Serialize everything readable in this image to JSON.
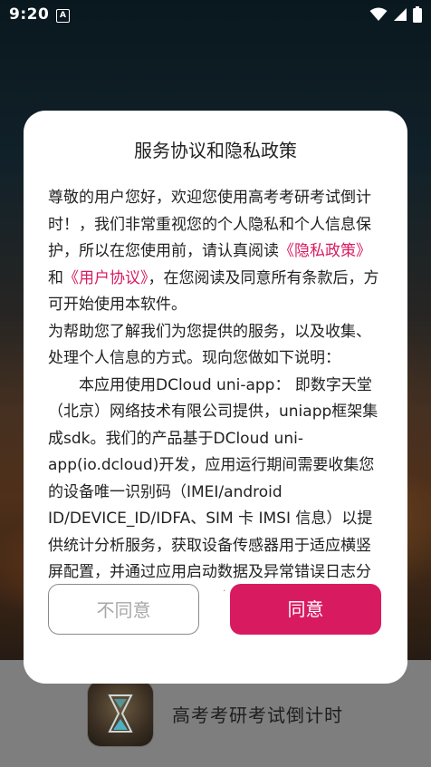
{
  "status_bar": {
    "time": "9:20",
    "notification_icon": "A",
    "icons": [
      "wifi-icon",
      "signal-icon",
      "battery-icon"
    ]
  },
  "dialog": {
    "title": "服务协议和隐私政策",
    "p1_a": "尊敬的用户您好，欢迎您使用高考考研考试倒计时！，我们非常重视您的个人隐私和个人信息保护，所以在您使用前，请认真阅读",
    "p1_link1": "《隐私政策》",
    "p1_and": "和",
    "p1_link2": "《用户协议》",
    "p1_b": "，在您阅读及同意所有条款后，方可开始使用本软件。",
    "p2": "为帮助您了解我们为您提供的服务，以及收集、处理个人信息的方式。现向您做如下说明：",
    "p3": "本应用使用DCloud uni-app： 即数字天堂（北京）网络技术有限公司提供，uniapp框架集成sdk。我们的产品基于DCloud uni-app(io.dcloud)开发，应用运行期间需要收集您的设备唯一识别码（IMEI/android ID/DEVICE_ID/IDFA、SIM 卡 IMSI 信息）以提供统计分析服务，获取设备传感器用于适应横竖屏配置，并通过应用启动数据及异常错误日志分析改进性能和用户体验，为用户提供更",
    "disagree_label": "不同意",
    "agree_label": "同意"
  },
  "footer": {
    "app_name": "高考考研考试倒计时"
  },
  "colors": {
    "accent": "#d81b60",
    "footer_bg": "#7e7e7e"
  }
}
